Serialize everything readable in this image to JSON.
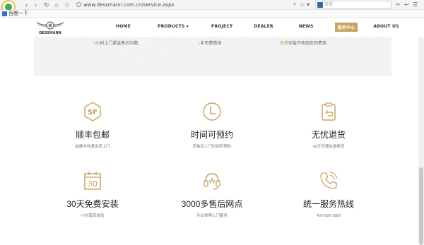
{
  "browser": {
    "url": "www.dessmann.com.cn/service.aspx",
    "search_placeholder": "百度",
    "bookmark_label": "百度一下"
  },
  "site": {
    "brand": "DESSMANN",
    "nav": [
      {
        "label": "HOME"
      },
      {
        "label": "PRODUCTS ▾"
      },
      {
        "label": "PROJECT"
      },
      {
        "label": "DEALER"
      },
      {
        "label": "NEWS"
      },
      {
        "label": "服务中心",
        "active": true
      },
      {
        "label": "ABOUT US"
      }
    ]
  },
  "banner": {
    "items": [
      {
        "highlight": "2",
        "text": "小时上门紧急售后问题"
      },
      {
        "highlight": "1",
        "text": "年免费质保"
      },
      {
        "highlight": "免费",
        "text": "安装不收取任何费用"
      }
    ]
  },
  "services": [
    {
      "icon": "sf-express-icon",
      "title": "顺丰包邮",
      "desc": "由顺丰快递送货上门"
    },
    {
      "icon": "clock-icon",
      "title": "时间可预约",
      "desc": "安装及上门时间可预约"
    },
    {
      "icon": "return-box-icon",
      "title": "无忧退货",
      "desc": "60天无理由退换货"
    },
    {
      "icon": "calendar-30-icon",
      "title": "30天免费安装",
      "desc": "小时尊享体验",
      "calendar_number": "30"
    },
    {
      "icon": "headset-icon",
      "title": "3000多售后网点",
      "desc": "专业师傅上门服务"
    },
    {
      "icon": "phone-icon",
      "title": "统一服务热线",
      "desc": "400-880-1889"
    }
  ],
  "colors": {
    "accent": "#c9a15e",
    "text": "#222222",
    "muted": "#777777"
  }
}
